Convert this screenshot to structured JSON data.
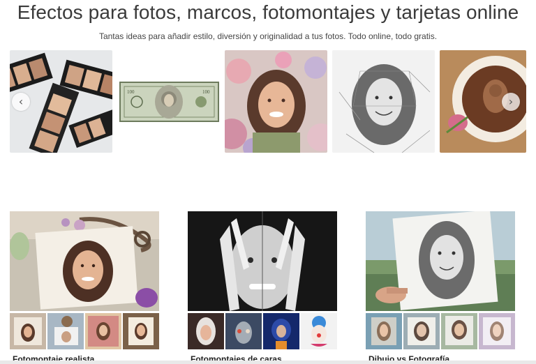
{
  "header": {
    "title": "Efectos para fotos, marcos, fotomontajes y tarjetas online",
    "subtitle": "Tantas ideas para añadir estilo, diversión y originalidad a tus fotos. Todo online, todo gratis."
  },
  "carousel": {
    "prev_icon": "chevron-left-icon",
    "next_icon": "chevron-right-icon",
    "prev_glyph": "‹",
    "next_glyph": "›"
  },
  "cards": [
    {
      "title": "Fotomontaje realista"
    },
    {
      "title": "Fotomontajes de caras"
    },
    {
      "title": "Dibujo vs Fotografía"
    }
  ],
  "colors": {
    "title": "#3a3a3a",
    "background": "#ffffff"
  }
}
